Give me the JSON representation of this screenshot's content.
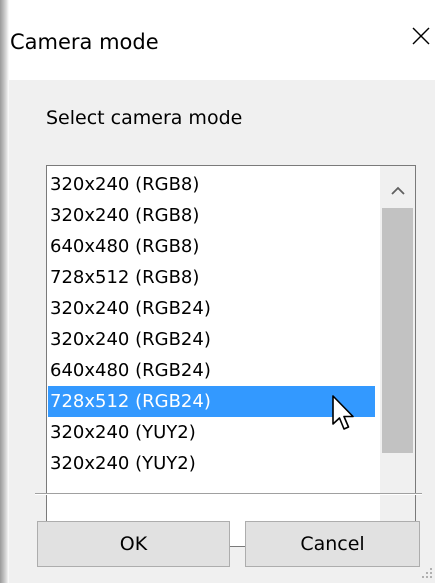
{
  "dialog": {
    "title": "Camera mode",
    "prompt": "Select camera mode",
    "close_icon": "close-icon"
  },
  "modes": {
    "items": [
      "320x240 (RGB8)",
      "320x240 (RGB8)",
      "640x480 (RGB8)",
      "728x512 (RGB8)",
      "320x240 (RGB24)",
      "320x240 (RGB24)",
      "640x480 (RGB24)",
      "728x512 (RGB24)",
      "320x240 (YUY2)",
      "320x240 (YUY2)"
    ],
    "selected_index": 7,
    "selected_value": "728x512 (RGB24)"
  },
  "buttons": {
    "ok": "OK",
    "cancel": "Cancel"
  },
  "colors": {
    "selection": "#3399ff",
    "client_background": "#f0f0f0",
    "button_face": "#e1e1e1"
  }
}
